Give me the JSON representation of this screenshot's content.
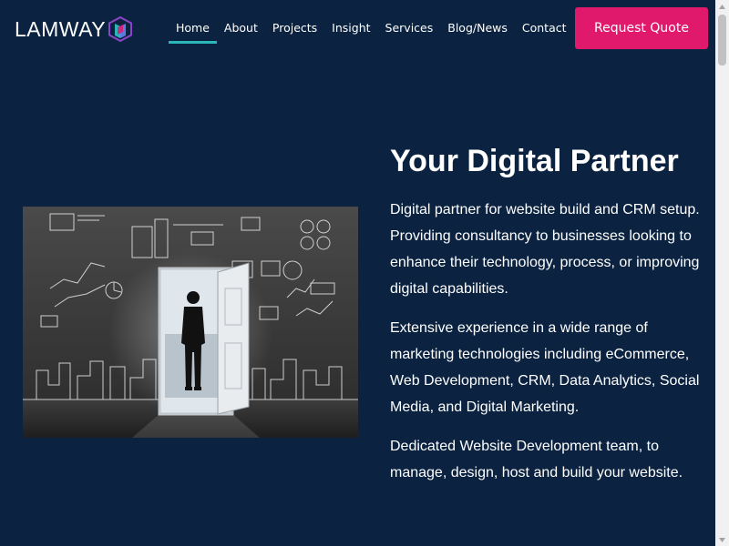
{
  "brand": {
    "logo_text": "LAMWAY",
    "colors": {
      "background": "#0b2340",
      "accent": "#e0196c",
      "nav_underline": "#2bb6b8"
    }
  },
  "nav": {
    "items": [
      {
        "label": "Home",
        "active": true
      },
      {
        "label": "About"
      },
      {
        "label": "Projects"
      },
      {
        "label": "Insight"
      },
      {
        "label": "Services"
      },
      {
        "label": "Blog/News"
      },
      {
        "label": "Contact"
      }
    ],
    "cta_label": "Request Quote"
  },
  "hero": {
    "title": "Your Digital Partner",
    "paragraphs": [
      "Digital partner for website build and CRM setup. Providing consultancy to businesses looking to enhance their technology, process, or improving digital capabilities.",
      "Extensive experience in a wide range of marketing technologies including eCommerce, Web Development, CRM, Data Analytics, Social Media, and Digital Marketing.",
      "Dedicated Website Development team, to manage, design, host and build your website."
    ],
    "image_icon": "businessman-doorway-chalkboard-illustration"
  },
  "scrollbar": {
    "position": 0.0
  }
}
